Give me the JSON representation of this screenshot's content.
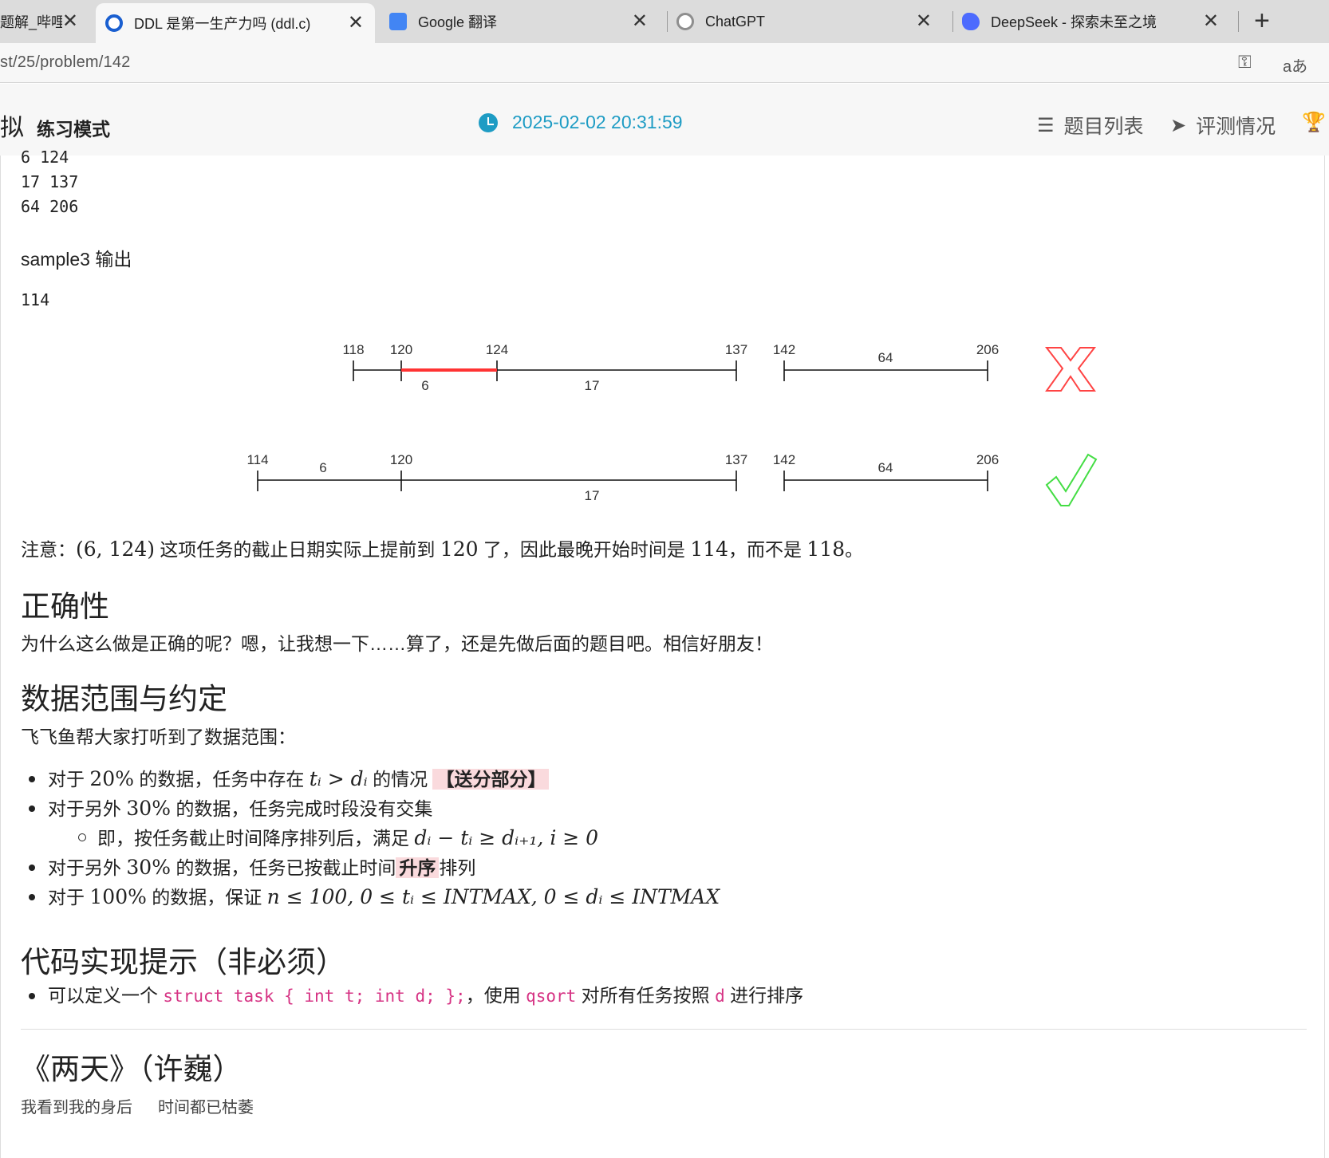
{
  "browser": {
    "tabs": [
      {
        "title": "题解_哔哩哔",
        "fav_color": "#00a1d6"
      },
      {
        "title": "DDL 是第一生产力吗 (ddl.c)",
        "fav_color": "#1a5fd0"
      },
      {
        "title": "Google 翻译",
        "fav_color": "#4285f4"
      },
      {
        "title": "ChatGPT",
        "fav_color": "#8e8e8e"
      },
      {
        "title": "DeepSeek - 探索未至之境",
        "fav_color": "#4d6bfe"
      }
    ],
    "close_glyph": "✕",
    "new_tab_glyph": "+",
    "url": "st/25/problem/142",
    "addr_icons": [
      "key-icon",
      "translate-icon"
    ]
  },
  "header": {
    "brand": "拟",
    "mode": "练习模式",
    "time": "2025-02-02 20:31:59",
    "nav": [
      {
        "label": "题目列表",
        "icon": "list-icon"
      },
      {
        "label": "评测情况",
        "icon": "paper-plane-icon"
      }
    ],
    "trophy_icon": "trophy-icon"
  },
  "content": {
    "input_lines": [
      "6 124",
      "17 137",
      "64 206"
    ],
    "sample3_label": "sample3 输出",
    "sample3_output": "114",
    "diagram": {
      "wrong": {
        "ticks": [
          "118",
          "120",
          "124",
          "137",
          "142",
          "206"
        ],
        "segment_labels": [
          "6",
          "17",
          "64"
        ],
        "mark": "cross-icon"
      },
      "right": {
        "ticks": [
          "114",
          "120",
          "137",
          "142",
          "206"
        ],
        "segment_labels": [
          "6",
          "17",
          "64"
        ],
        "mark": "check-icon"
      }
    },
    "note": {
      "prefix": "注意：",
      "pair": "(6, 124)",
      "mid": " 这项任务的截止日期实际上提前到 ",
      "v120": "120",
      "mid2": " 了，因此最晚开始时间是 ",
      "v114": "114",
      "mid3": "，而不是 ",
      "v118": "118",
      "end": "。"
    },
    "section_correctness": {
      "title": "正确性",
      "text": "为什么这么做是正确的呢？嗯，让我想一下……算了，还是先做后面的题目吧。相信好朋友！"
    },
    "section_range": {
      "title": "数据范围与约定",
      "intro": "飞飞鱼帮大家打听到了数据范围：",
      "b1_pre": "对于 ",
      "b1_pct": "20%",
      "b1_mid": " 的数据，任务中存在 ",
      "b1_math": "tᵢ > dᵢ",
      "b1_post": " 的情况 ",
      "b1_tag": "【送分部分】",
      "b2_pre": "对于另外 ",
      "b2_pct": "30%",
      "b2_post": " 的数据，任务完成时段没有交集",
      "b2s_text": "即，按任务截止时间降序排列后，满足 ",
      "b2s_math": "dᵢ − tᵢ ≥ dᵢ₊₁, i ≥ 0",
      "b3_pre": "对于另外 ",
      "b3_pct": "30%",
      "b3_mid": " 的数据，任务已按截止时间",
      "b3_tag": "升序",
      "b3_post": "排列",
      "b4_pre": "对于 ",
      "b4_pct": "100%",
      "b4_mid": " 的数据，保证 ",
      "b4_math": "n ≤ 100, 0 ≤ tᵢ ≤ INTMAX, 0 ≤ dᵢ ≤ INTMAX"
    },
    "section_hint": {
      "title": "代码实现提示（非必须）",
      "pre": "可以定义一个 ",
      "code1": "struct task { int t; int d; };",
      "mid": "，使用 ",
      "code2": "qsort",
      "mid2": " 对所有任务按照 ",
      "code3": "d",
      "post": " 进行排序"
    },
    "poem": {
      "title": "《两天》（许巍）",
      "line1": "我看到我的身后",
      "line2": "时间都已枯萎"
    }
  }
}
